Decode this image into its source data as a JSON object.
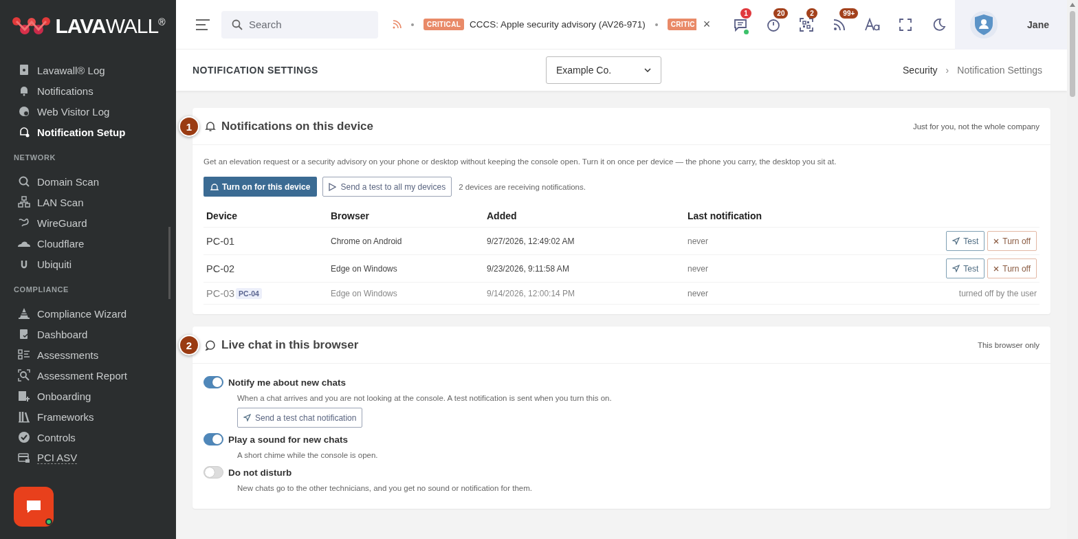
{
  "sidebar": {
    "logo": "**LAVA**WALL$^{®}$",
    "items": [
      {
        "kind": "item",
        "label": "Lavawall® Log",
        "selected": false,
        "dotted": false
      },
      {
        "kind": "item",
        "label": "Notifications",
        "selected": false,
        "dotted": false
      },
      {
        "kind": "item",
        "label": "Web Visitor Log",
        "selected": false,
        "dotted": false
      },
      {
        "kind": "item",
        "label": "Notification Setup",
        "selected": true,
        "dotted": false
      },
      {
        "kind": "heading",
        "label": "NETWORK"
      },
      {
        "kind": "item",
        "label": "Domain Scan",
        "selected": false,
        "dotted": false
      },
      {
        "kind": "item",
        "label": "LAN Scan",
        "selected": false,
        "dotted": false
      },
      {
        "kind": "item",
        "label": "WireGuard",
        "selected": false,
        "dotted": false
      },
      {
        "kind": "item",
        "label": "Cloudflare",
        "selected": false,
        "dotted": false
      },
      {
        "kind": "item",
        "label": "Ubiquiti",
        "selected": false,
        "dotted": false
      },
      {
        "kind": "heading",
        "label": "COMPLIANCE"
      },
      {
        "kind": "item",
        "label": "Compliance Wizard",
        "selected": false,
        "dotted": false
      },
      {
        "kind": "item",
        "label": "Dashboard",
        "selected": false,
        "dotted": false
      },
      {
        "kind": "item",
        "label": "Assessments",
        "selected": false,
        "dotted": false
      },
      {
        "kind": "item",
        "label": "Assessment Report",
        "selected": false,
        "dotted": false
      },
      {
        "kind": "item",
        "label": "Onboarding",
        "selected": false,
        "dotted": false
      },
      {
        "kind": "item",
        "label": "Frameworks",
        "selected": false,
        "dotted": false
      },
      {
        "kind": "item",
        "label": "Controls",
        "selected": false,
        "dotted": false
      },
      {
        "kind": "item",
        "label": "PCI ASV",
        "selected": false,
        "dotted": true
      }
    ]
  },
  "topbar": {
    "search": {
      "placeholder": "Search"
    },
    "ticker": [
      {
        "tag": "CRITICAL",
        "text": "CCCS: Apple security advisory (AV26-971)"
      },
      {
        "tag": "CRITIC"
      }
    ],
    "close": "×",
    "icons": [
      {
        "badge": "1",
        "color": "#e0393e",
        "online": true
      },
      {
        "badge": "20",
        "color": "#a3411c",
        "online": false
      },
      {
        "badge": "2",
        "color": "#a3411c",
        "online": false
      },
      {
        "badge": "99+",
        "color": "#a3411c",
        "online": false
      }
    ],
    "user": "Jane"
  },
  "header": {
    "title": "NOTIFICATION SETTINGS",
    "company": "Example Co.",
    "breadcrumb": [
      "Security",
      "Notification Settings"
    ],
    "separator": "›"
  },
  "device_card": {
    "number": "1",
    "title": "Notifications on this device",
    "hint": "Just for you, not the whole company",
    "intro": "Get an elevation request or a security advisory on your phone or desktop without keeping the console open. Turn it on once per device — the phone you carry, the desktop you sit at.",
    "primary": "Turn on for this device",
    "secondary": "Send a test to all my devices",
    "status": "2 devices are receiving notifications.",
    "columns": [
      "Device",
      "Browser",
      "Added",
      "Last notification"
    ],
    "rows": [
      {
        "device": "PC-01",
        "browser": "Chrome on Android",
        "added": "9/27/2026, 12:49:02 AM",
        "last": "never",
        "disabled": false,
        "actions": [
          "Test",
          "Turn off"
        ]
      },
      {
        "device": "PC-02",
        "browser": "Edge on Windows",
        "added": "9/23/2026, 9:11:58 AM",
        "last": "never",
        "disabled": false,
        "actions": [
          "Test",
          "Turn off"
        ]
      },
      {
        "device": "PC-03",
        "tag": "PC-04",
        "browser": "Edge on Windows",
        "added": "9/14/2026, 12:00:14 PM",
        "last": "never",
        "disabled": true,
        "status": "turned off by the user"
      }
    ]
  },
  "chat_card": {
    "number": "2",
    "title": "Live chat in this browser",
    "hint": "This browser only",
    "options": [
      {
        "label": "Notify me about new chats",
        "on": true,
        "description": "When a chat arrives and you are not looking at the console. A test notification is sent when you turn this on.",
        "button": "Send a test chat notification"
      },
      {
        "label": "Play a sound for new chats",
        "on": true,
        "description": "A short chime while the console is open."
      },
      {
        "label": "Do not disturb",
        "on": false,
        "description": "New chats go to the other technicians, and you get no sound or notification for them."
      }
    ]
  }
}
